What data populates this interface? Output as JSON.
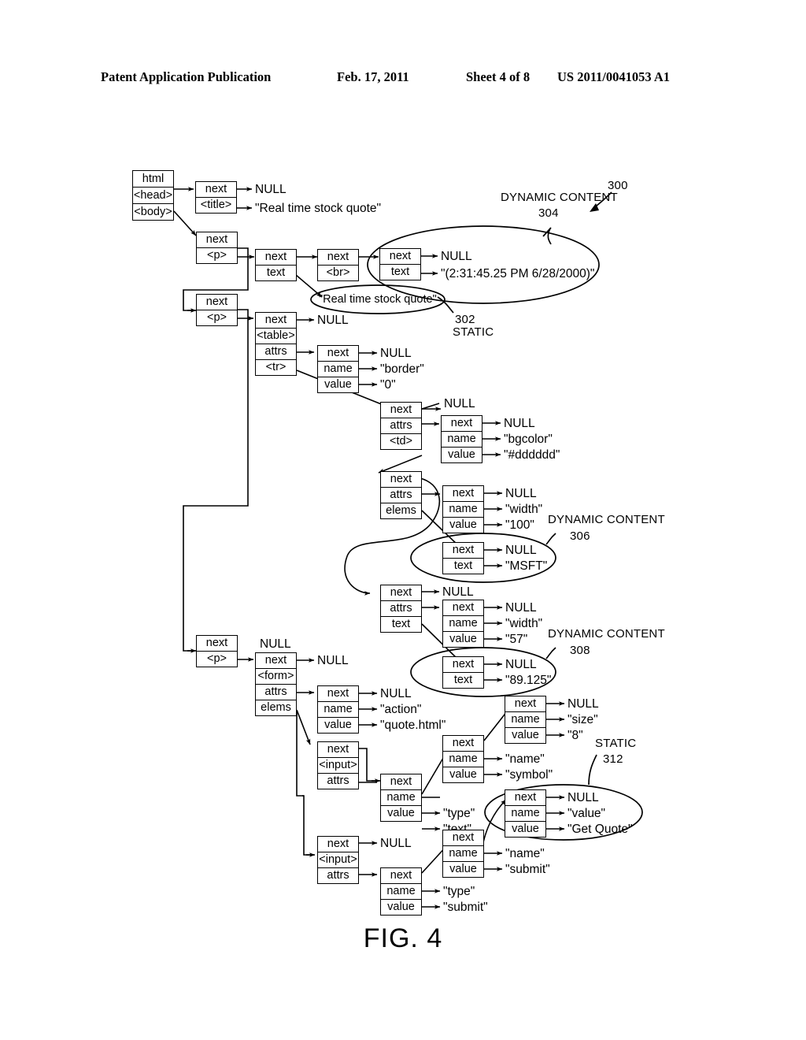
{
  "header": {
    "publication": "Patent Application Publication",
    "date": "Feb. 17, 2011",
    "sheet": "Sheet 4 of 8",
    "patent_number": "US 2011/0041053 A1"
  },
  "figure": {
    "caption": "FIG. 4",
    "reference_numeral": "300"
  },
  "annotations": {
    "dyn304_line1": "DYNAMIC CONTENT",
    "dyn304_line2": "304",
    "static302_num": "302",
    "static302_word": "STATIC",
    "dyn306_line1": "DYNAMIC CONTENT",
    "dyn306_line2": "306",
    "dyn308_line1": "DYNAMIC CONTENT",
    "dyn308_line2": "308",
    "static312_word": "STATIC",
    "static312_num": "312"
  },
  "nodes": {
    "html_root": {
      "c0": "html",
      "c1": "<head>",
      "c2": "<body>"
    },
    "title": {
      "c0": "next",
      "c1": "<title>"
    },
    "p1": {
      "c0": "next",
      "c1": "<p>"
    },
    "text1": {
      "c0": "next",
      "c1": "text"
    },
    "br": {
      "c0": "next",
      "c1": "<br>"
    },
    "text2": {
      "c0": "next",
      "c1": "text"
    },
    "p2": {
      "c0": "next",
      "c1": "<p>"
    },
    "table": {
      "c0": "next",
      "c1": "<table>",
      "c2": "attrs",
      "c3": "<tr>"
    },
    "attr_border": {
      "c0": "next",
      "c1": "name",
      "c2": "value"
    },
    "td1": {
      "c0": "next",
      "c1": "attrs",
      "c2": "<td>"
    },
    "attr_bgcolor": {
      "c0": "next",
      "c1": "name",
      "c2": "value"
    },
    "td2": {
      "c0": "next",
      "c1": "attrs",
      "c2": "elems"
    },
    "attr_width100": {
      "c0": "next",
      "c1": "name",
      "c2": "value"
    },
    "text_msft": {
      "c0": "next",
      "c1": "text"
    },
    "td3": {
      "c0": "next",
      "c1": "attrs",
      "c2": "text"
    },
    "attr_width57": {
      "c0": "next",
      "c1": "name",
      "c2": "value"
    },
    "text_price": {
      "c0": "next",
      "c1": "text"
    },
    "p3": {
      "c0": "next",
      "c1": "<p>"
    },
    "form": {
      "c0": "next",
      "c1": "<form>",
      "c2": "attrs",
      "c3": "elems"
    },
    "attr_action": {
      "c0": "next",
      "c1": "name",
      "c2": "value"
    },
    "input1": {
      "c0": "next",
      "c1": "<input>",
      "c2": "attrs"
    },
    "attr_size": {
      "c0": "next",
      "c1": "name",
      "c2": "value"
    },
    "attr_name_symbol": {
      "c0": "next",
      "c1": "name",
      "c2": "value"
    },
    "attr_type_text": {
      "c0": "next",
      "c1": "name",
      "c2": "value"
    },
    "attr_value_getquote": {
      "c0": "next",
      "c1": "name",
      "c2": "value"
    },
    "input2": {
      "c0": "next",
      "c1": "<input>",
      "c2": "attrs"
    },
    "attr_name_submit": {
      "c0": "next",
      "c1": "name",
      "c2": "value"
    },
    "attr_type_submit": {
      "c0": "next",
      "c1": "name",
      "c2": "value"
    }
  },
  "values": {
    "null_title_next": "NULL",
    "title_text": "\"Real time stock quote\"",
    "null_text2_next": "NULL",
    "timestamp": "\"(2:31:45.25 PM 6/28/2000)\"",
    "static_text_ellipse": "\"Real time stock quote\"",
    "null_table_next": "NULL",
    "null_border_next": "NULL",
    "border_name": "\"border\"",
    "border_value": "\"0\"",
    "null_td1_next": "NULL",
    "null_bgcolor_next": "NULL",
    "bgcolor_name": "\"bgcolor\"",
    "bgcolor_value": "\"#dddddd\"",
    "null_width100_next": "NULL",
    "width100_name": "\"width\"",
    "width100_value": "\"100\"",
    "null_msft_next": "NULL",
    "msft_text": "\"MSFT\"",
    "null_td3_next": "NULL",
    "null_width57_next": "NULL",
    "width57_name": "\"width\"",
    "width57_value": "\"57\"",
    "null_price_next": "NULL",
    "price_text": "\"89.125\"",
    "null_above_form": "NULL",
    "null_form_next": "NULL",
    "null_action_next": "NULL",
    "action_name": "\"action\"",
    "action_value": "\"quote.html\"",
    "null_size_next": "NULL",
    "size_name": "\"size\"",
    "size_value": "\"8\"",
    "symbol_name": "\"name\"",
    "symbol_value": "\"symbol\"",
    "type_text_name": "\"type\"",
    "type_text_value": "\"text\"",
    "null_getquote_next": "NULL",
    "getquote_name": "\"value\"",
    "getquote_value": "\"Get Quote\"",
    "null_input2_next": "NULL",
    "namesubmit_name": "\"name\"",
    "namesubmit_value": "\"submit\"",
    "typesubmit_name": "\"type\"",
    "typesubmit_value": "\"submit\""
  }
}
